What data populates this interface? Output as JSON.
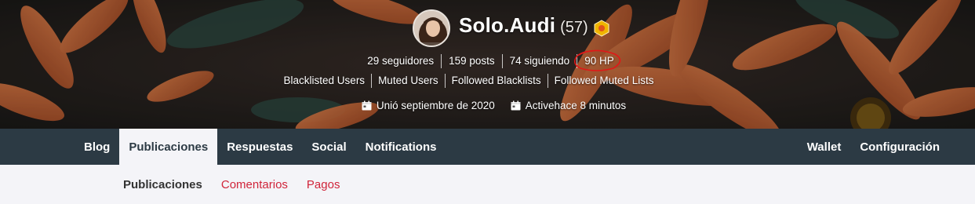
{
  "profile": {
    "username": "Solo.Audi",
    "reputation": "(57)",
    "avatar": "avatar",
    "badge_icon": "hive-badge-icon"
  },
  "stats": {
    "followers": "29 seguidores",
    "posts": "159 posts",
    "following": "74 siguiendo",
    "hp": "90 HP"
  },
  "lists": {
    "blacklisted": "Blacklisted Users",
    "muted": "Muted Users",
    "followed_blacklists": "Followed Blacklists",
    "followed_muted": "Followed Muted Lists"
  },
  "meta": {
    "joined": "Unió septiembre de 2020",
    "active": "Activehace 8 minutos"
  },
  "nav": {
    "left": [
      "Blog",
      "Publicaciones",
      "Respuestas",
      "Social",
      "Notifications"
    ],
    "right": [
      "Wallet",
      "Configuración"
    ],
    "active": "Publicaciones"
  },
  "subnav": {
    "items": [
      "Publicaciones",
      "Comentarios",
      "Pagos"
    ],
    "active": "Publicaciones"
  },
  "colors": {
    "navbar": "#2c3a44",
    "link_red": "#d0243a",
    "hp_annotation": "#e01818",
    "badge": "#f0b400"
  }
}
